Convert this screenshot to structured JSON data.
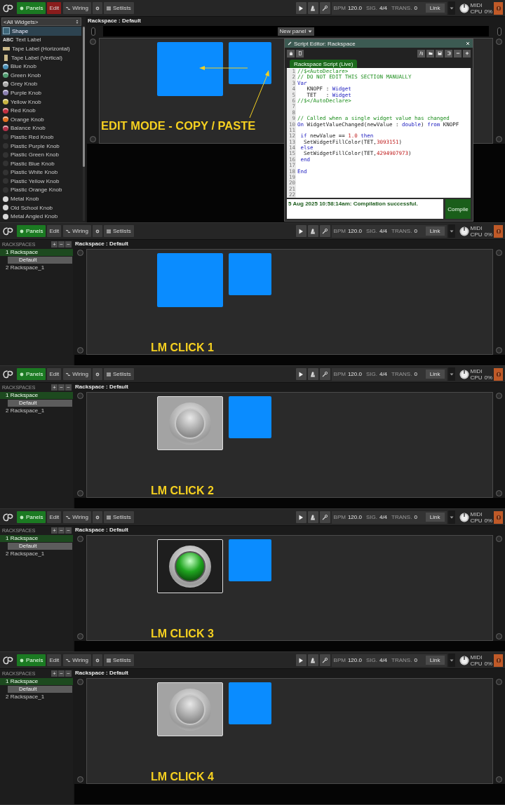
{
  "frames": [
    {
      "kind": "edit",
      "toolbar": {
        "panels": "Panels",
        "edit": "Edit",
        "edit_on": true,
        "wiring": "Wiring",
        "setlists": "Setlists",
        "bpm_label": "BPM",
        "bpm": "120.0",
        "sig_label": "SIG.",
        "sig": "4/4",
        "trans_label": "TRANS.",
        "trans": "0",
        "link": "Link",
        "midi": "MIDI",
        "cpu_label": "CPU",
        "cpu": "0%"
      },
      "palette": {
        "filter": "<All Widgets>",
        "items": [
          {
            "label": "Shape",
            "kind": "shape",
            "selected": true
          },
          {
            "label": "Text Label",
            "kind": "text",
            "icon_text": "ABC",
            "selected": false
          },
          {
            "label": "Tape Label (Horizontal)",
            "kind": "tape-h",
            "selected": false
          },
          {
            "label": "Tape Label (Vertical)",
            "kind": "tape-v",
            "selected": false
          },
          {
            "label": "Blue Knob",
            "kind": "knob",
            "color": "#4a90b8",
            "selected": false
          },
          {
            "label": "Green Knob",
            "kind": "knob",
            "color": "#4f9a6f",
            "selected": false
          },
          {
            "label": "Grey Knob",
            "kind": "knob",
            "color": "#a8a8a8",
            "selected": false
          },
          {
            "label": "Purple Knob",
            "kind": "knob",
            "color": "#8a7fb0",
            "selected": false
          },
          {
            "label": "Yellow Knob",
            "kind": "knob",
            "color": "#c8b440",
            "selected": false
          },
          {
            "label": "Red Knob",
            "kind": "knob",
            "color": "#c03040",
            "selected": false
          },
          {
            "label": "Orange Knob",
            "kind": "knob",
            "color": "#e07020",
            "selected": false
          },
          {
            "label": "Balance Knob",
            "kind": "knob",
            "color": "#b03048",
            "selected": false
          },
          {
            "label": "Plastic Red Knob",
            "kind": "plastic",
            "selected": false
          },
          {
            "label": "Plastic Purple Knob",
            "kind": "plastic",
            "selected": false
          },
          {
            "label": "Plastic Green Knob",
            "kind": "plastic",
            "selected": false
          },
          {
            "label": "Plastic Blue Knob",
            "kind": "plastic",
            "selected": false
          },
          {
            "label": "Plastic White Knob",
            "kind": "plastic",
            "selected": false
          },
          {
            "label": "Plastic Yellow Knob",
            "kind": "plastic",
            "selected": false
          },
          {
            "label": "Plastic Orange Knob",
            "kind": "plastic",
            "selected": false
          },
          {
            "label": "Metal Knob",
            "kind": "metal",
            "selected": false
          },
          {
            "label": "Old School Knob",
            "kind": "metal",
            "selected": false
          },
          {
            "label": "Metal Angled Knob",
            "kind": "metal",
            "selected": false
          }
        ]
      },
      "title": "Rackspace : Default",
      "panel_menu": "New panel",
      "widgets": [
        {
          "kind": "shape",
          "color": "#0a8cff"
        },
        {
          "kind": "shape",
          "color": "#0a8cff"
        }
      ],
      "caption": "EDIT MODE - COPY / PASTE",
      "script_editor": {
        "title": "Script Editor: Rackspace",
        "tab": "Rackspace Script (Live)",
        "lines": [
          {
            "n": "1",
            "segs": [
              {
                "kind": "comment",
                "text": "//$<AutoDeclare>"
              }
            ]
          },
          {
            "n": "2",
            "segs": [
              {
                "kind": "comment",
                "text": "// DO NOT EDIT THIS SECTION MANUALLY"
              }
            ]
          },
          {
            "n": "3",
            "segs": [
              {
                "kind": "keyword",
                "text": "Var"
              }
            ]
          },
          {
            "n": "4",
            "segs": [
              {
                "kind": "plain",
                "text": "   KNOPF : "
              },
              {
                "kind": "keyword",
                "text": "Widget"
              }
            ]
          },
          {
            "n": "5",
            "segs": [
              {
                "kind": "plain",
                "text": "   TET   : "
              },
              {
                "kind": "keyword",
                "text": "Widget"
              }
            ]
          },
          {
            "n": "6",
            "segs": [
              {
                "kind": "comment",
                "text": "//$</AutoDeclare>"
              }
            ]
          },
          {
            "n": "7"
          },
          {
            "n": "8"
          },
          {
            "n": "9",
            "segs": [
              {
                "kind": "comment",
                "text": "// Called when a single widget value has changed"
              }
            ]
          },
          {
            "n": "10",
            "segs": [
              {
                "kind": "keyword",
                "text": "On"
              },
              {
                "kind": "plain",
                "text": " WidgetValueChanged(newValue : "
              },
              {
                "kind": "keyword",
                "text": "double"
              },
              {
                "kind": "plain",
                "text": ") "
              },
              {
                "kind": "keyword",
                "text": "from"
              },
              {
                "kind": "plain",
                "text": " KNOPF"
              }
            ]
          },
          {
            "n": "11"
          },
          {
            "n": "12",
            "segs": [
              {
                "kind": "keyword",
                "text": " if"
              },
              {
                "kind": "plain",
                "text": " newValue == "
              },
              {
                "kind": "number",
                "text": "1.0"
              },
              {
                "kind": "keyword",
                "text": " then"
              }
            ]
          },
          {
            "n": "13",
            "segs": [
              {
                "kind": "plain",
                "text": "  SetWidgetFillColor(TET,"
              },
              {
                "kind": "number",
                "text": "3093151"
              },
              {
                "kind": "plain",
                "text": ")"
              }
            ]
          },
          {
            "n": "14",
            "segs": [
              {
                "kind": "keyword",
                "text": " else"
              }
            ]
          },
          {
            "n": "15",
            "segs": [
              {
                "kind": "plain",
                "text": "  SetWidgetFillColor(TET,"
              },
              {
                "kind": "number",
                "text": "4294907973"
              },
              {
                "kind": "plain",
                "text": ")"
              }
            ]
          },
          {
            "n": "16",
            "segs": [
              {
                "kind": "keyword",
                "text": " end"
              }
            ]
          },
          {
            "n": "17"
          },
          {
            "n": "18",
            "segs": [
              {
                "kind": "keyword",
                "text": "End"
              }
            ]
          },
          {
            "n": "19"
          },
          {
            "n": "20"
          },
          {
            "n": "21"
          },
          {
            "n": "22"
          }
        ],
        "status": "5 Aug 2025 10:58:14am: Compilation successful.",
        "compile": "Compile"
      }
    },
    {
      "kind": "perform",
      "toolbar": {
        "panels": "Panels",
        "edit": "Edit",
        "edit_on": false,
        "wiring": "Wiring",
        "setlists": "Setlists",
        "bpm_label": "BPM",
        "bpm": "120.0",
        "sig_label": "SIG.",
        "sig": "4/4",
        "trans_label": "TRANS.",
        "trans": "0",
        "link": "Link",
        "midi": "MIDI",
        "cpu_label": "CPU",
        "cpu": "0%"
      },
      "rackspaces": {
        "header": "RACKSPACES",
        "buttons": [
          "+",
          "−",
          "−"
        ],
        "items": [
          {
            "label": "1 Rackspace",
            "selected": true,
            "children": [
              {
                "label": "Default",
                "selected": true
              }
            ]
          },
          {
            "label": "2 Rackspace_1",
            "selected": false
          }
        ]
      },
      "title": "Rackspace : Default",
      "widgets": [
        {
          "kind": "shape",
          "color": "#0a8cff"
        },
        {
          "kind": "shape",
          "color": "#0a8cff"
        }
      ],
      "caption": "LM CLICK 1"
    },
    {
      "kind": "perform",
      "toolbar": {
        "panels": "Panels",
        "edit": "Edit",
        "edit_on": false,
        "wiring": "Wiring",
        "setlists": "Setlists",
        "bpm_label": "BPM",
        "bpm": "120.0",
        "sig_label": "SIG.",
        "sig": "4/4",
        "trans_label": "TRANS.",
        "trans": "0",
        "link": "Link",
        "midi": "MIDI",
        "cpu_label": "CPU",
        "cpu": "0%"
      },
      "rackspaces": {
        "header": "RACKSPACES",
        "buttons": [
          "+",
          "−",
          "−"
        ],
        "items": [
          {
            "label": "1 Rackspace",
            "selected": true,
            "children": [
              {
                "label": "Default",
                "selected": true
              }
            ]
          },
          {
            "label": "2 Rackspace_1",
            "selected": false
          }
        ]
      },
      "title": "Rackspace : Default",
      "widgets": [
        {
          "kind": "led",
          "on": false
        },
        {
          "kind": "shape",
          "color": "#0a8cff"
        }
      ],
      "caption": "LM CLICK 2"
    },
    {
      "kind": "perform",
      "toolbar": {
        "panels": "Panels",
        "edit": "Edit",
        "edit_on": false,
        "wiring": "Wiring",
        "setlists": "Setlists",
        "bpm_label": "BPM",
        "bpm": "120.0",
        "sig_label": "SIG.",
        "sig": "4/4",
        "trans_label": "TRANS.",
        "trans": "0",
        "link": "Link",
        "midi": "MIDI",
        "cpu_label": "CPU",
        "cpu": "0%"
      },
      "rackspaces": {
        "header": "RACKSPACES",
        "buttons": [
          "+",
          "−",
          "−"
        ],
        "items": [
          {
            "label": "1 Rackspace",
            "selected": true,
            "children": [
              {
                "label": "Default",
                "selected": true
              }
            ]
          },
          {
            "label": "2 Rackspace_1",
            "selected": false
          }
        ]
      },
      "title": "Rackspace : Default",
      "widgets": [
        {
          "kind": "led",
          "on": true
        },
        {
          "kind": "shape",
          "color": "#0a8cff"
        }
      ],
      "caption": "LM CLICK 3"
    },
    {
      "kind": "perform",
      "toolbar": {
        "panels": "Panels",
        "edit": "Edit",
        "edit_on": false,
        "wiring": "Wiring",
        "setlists": "Setlists",
        "bpm_label": "BPM",
        "bpm": "120.0",
        "sig_label": "SIG.",
        "sig": "4/4",
        "trans_label": "TRANS.",
        "trans": "0",
        "link": "Link",
        "midi": "MIDI",
        "cpu_label": "CPU",
        "cpu": "0%"
      },
      "rackspaces": {
        "header": "RACKSPACES",
        "buttons": [
          "+",
          "−",
          "−"
        ],
        "items": [
          {
            "label": "1 Rackspace",
            "selected": true,
            "children": [
              {
                "label": "Default",
                "selected": true
              }
            ]
          },
          {
            "label": "2 Rackspace_1",
            "selected": false
          }
        ]
      },
      "title": "Rackspace : Default",
      "widgets": [
        {
          "kind": "led",
          "on": false
        },
        {
          "kind": "shape",
          "color": "#0a8cff"
        }
      ],
      "caption": "LM CLICK 4"
    }
  ]
}
